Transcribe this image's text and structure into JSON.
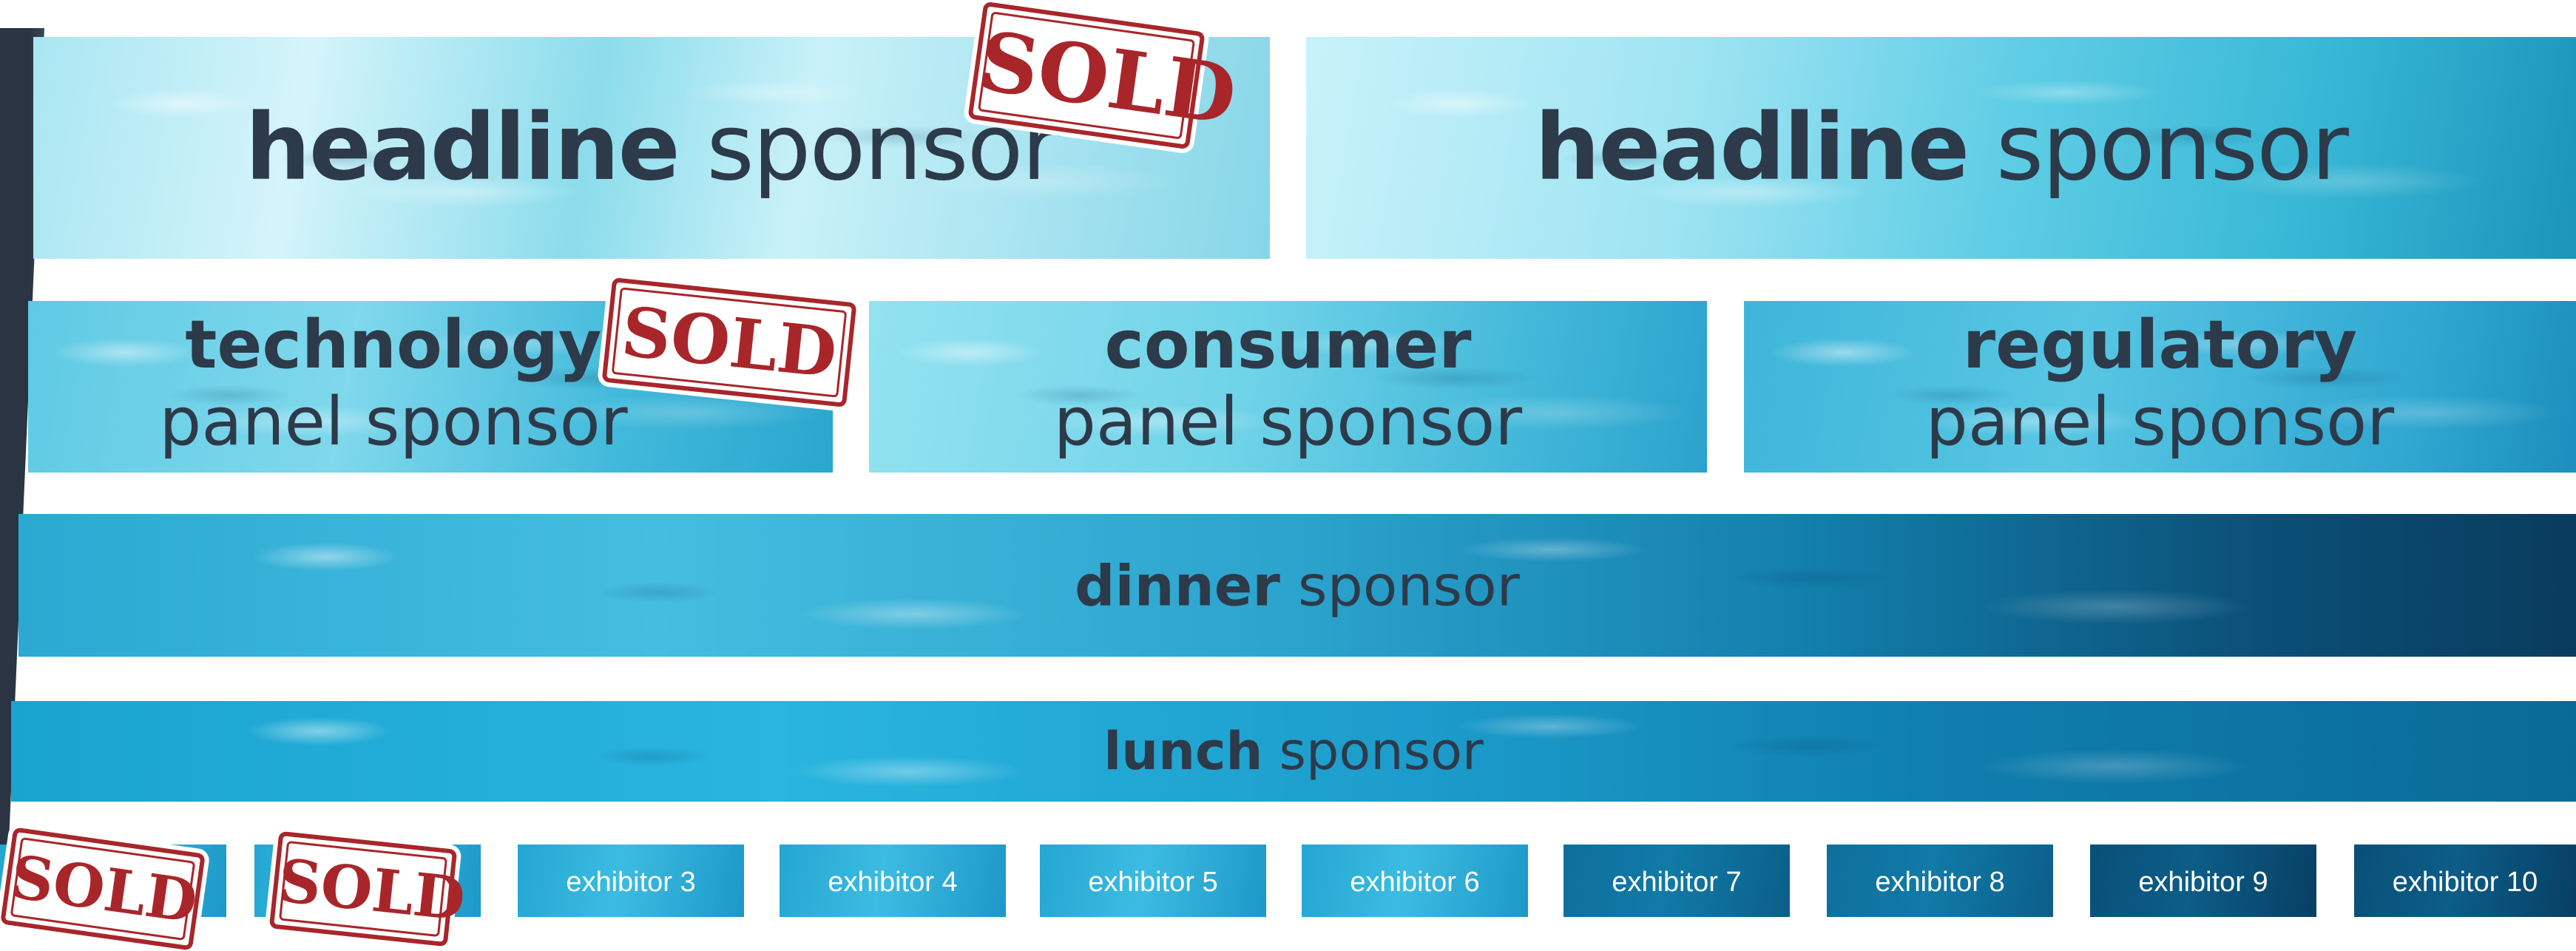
{
  "headline_sponsors": [
    {
      "bold": "headline",
      "rest": " sponsor",
      "sold": true
    },
    {
      "bold": "headline",
      "rest": " sponsor",
      "sold": false
    }
  ],
  "panel_sponsors": [
    {
      "bold": "technology",
      "rest": "panel sponsor",
      "sold": true
    },
    {
      "bold": "consumer",
      "rest": "panel sponsor",
      "sold": false
    },
    {
      "bold": "regulatory",
      "rest": "panel sponsor",
      "sold": false
    }
  ],
  "dinner": {
    "bold": "dinner",
    "rest": " sponsor"
  },
  "lunch": {
    "bold": "lunch",
    "rest": " sponsor"
  },
  "exhibitors": [
    {
      "label": "",
      "sold": true
    },
    {
      "label": "",
      "sold": true
    },
    {
      "label": "exhibitor 3"
    },
    {
      "label": "exhibitor 4"
    },
    {
      "label": "exhibitor 5"
    },
    {
      "label": "exhibitor 6"
    },
    {
      "label": "exhibitor 7"
    },
    {
      "label": "exhibitor 8"
    },
    {
      "label": "exhibitor 9"
    },
    {
      "label": "exhibitor 10"
    }
  ],
  "stamp_text": "SOLD",
  "colors": {
    "text": "#2d3a4a",
    "stamp": "#a8262a",
    "water": "#2ba9d2"
  }
}
